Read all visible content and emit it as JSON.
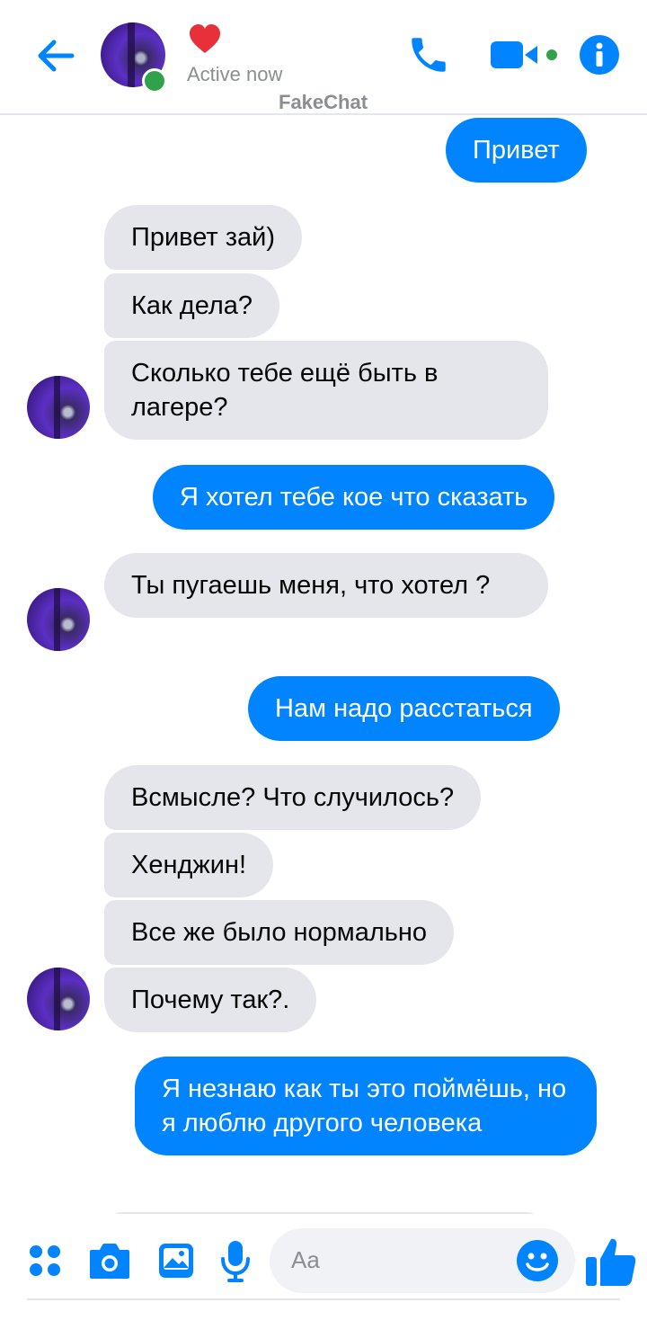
{
  "header": {
    "status_text": "Active now",
    "watermark": "FakeChat",
    "contact_emoji": "heart"
  },
  "messages": [
    {
      "dir": "out",
      "text": "Привет"
    },
    {
      "dir": "in",
      "text": "Привет зай)"
    },
    {
      "dir": "in",
      "text": "Как дела?"
    },
    {
      "dir": "in",
      "text": "Сколько тебе ещё быть в лагере?"
    },
    {
      "dir": "out",
      "text": "Я хотел тебе кое что сказать"
    },
    {
      "dir": "in",
      "text": "Ты пугаешь меня, что хотел ?"
    },
    {
      "dir": "out",
      "text": "Нам надо расстаться"
    },
    {
      "dir": "in",
      "text": "Всмысле? Что случилось?"
    },
    {
      "dir": "in",
      "text": "Хенджин!"
    },
    {
      "dir": "in",
      "text": "Все же было нормально"
    },
    {
      "dir": "in",
      "text": "Почему так?."
    },
    {
      "dir": "out",
      "text": "Я незнаю как ты это поймёшь, но я люблю другого человека"
    }
  ],
  "composer": {
    "placeholder": "Aa"
  },
  "colors": {
    "accent": "#0084ff",
    "incoming_bubble": "#e4e6eb",
    "online": "#31a24c"
  }
}
